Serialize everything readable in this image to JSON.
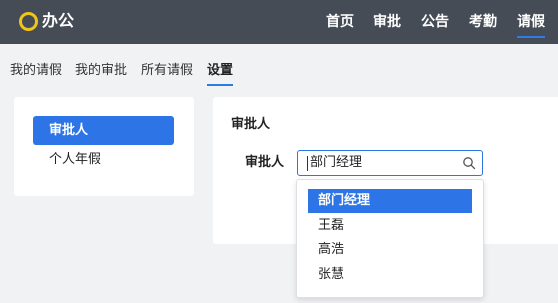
{
  "app": {
    "title": "办公"
  },
  "topnav": {
    "items": [
      {
        "label": "首页"
      },
      {
        "label": "审批"
      },
      {
        "label": "公告"
      },
      {
        "label": "考勤"
      },
      {
        "label": "请假",
        "active": true
      }
    ]
  },
  "subtabs": {
    "items": [
      {
        "label": "我的请假"
      },
      {
        "label": "我的审批"
      },
      {
        "label": "所有请假"
      },
      {
        "label": "设置",
        "active": true
      }
    ]
  },
  "sidebar": {
    "items": [
      {
        "label": "审批人",
        "active": true
      },
      {
        "label": "个人年假"
      }
    ]
  },
  "settings": {
    "section_title": "审批人",
    "approver_label": "审批人",
    "approver_value": "部门经理",
    "dropdown_options": [
      {
        "label": "部门经理",
        "selected": true
      },
      {
        "label": "王磊"
      },
      {
        "label": "高浩"
      },
      {
        "label": "张慧"
      }
    ]
  },
  "colors": {
    "topbar": "#454c56",
    "accent": "#2d74e6",
    "logo": "#f0c419",
    "page_bg": "#f1f2f4"
  },
  "icons": {
    "logo": "circle-logo-icon",
    "search": "search-icon"
  }
}
